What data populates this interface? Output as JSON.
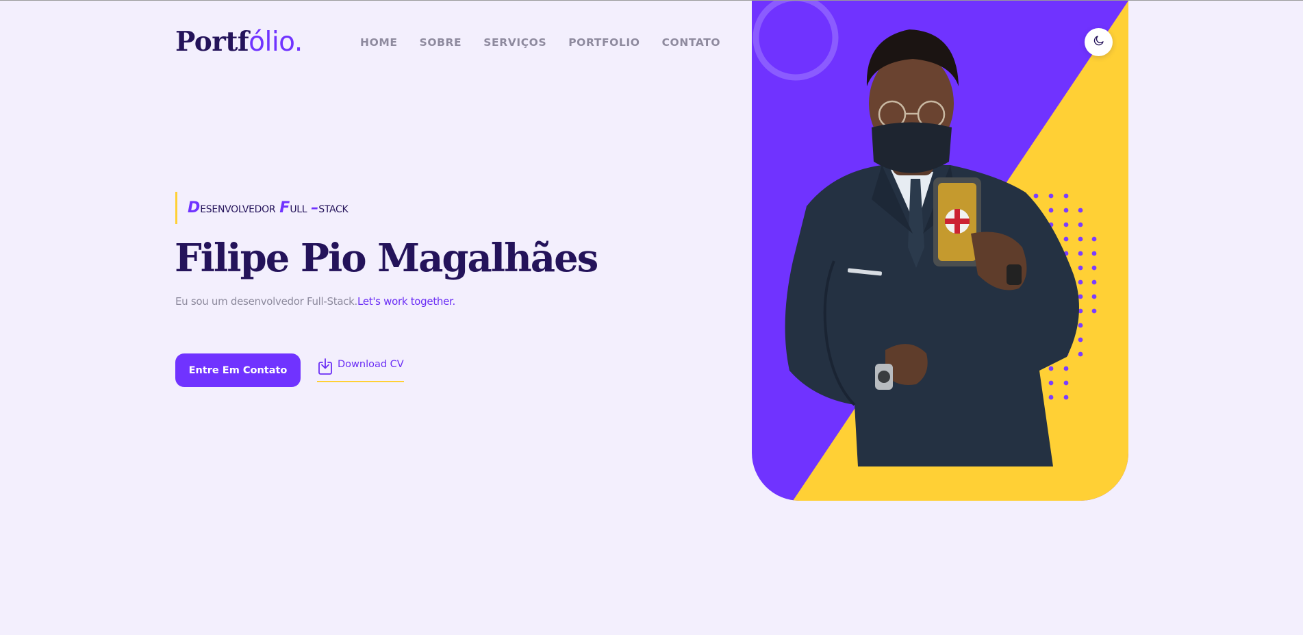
{
  "header": {
    "logo_main": "Portf",
    "logo_accent": "ólio.",
    "nav": [
      {
        "label": "HOME"
      },
      {
        "label": "SOBRE"
      },
      {
        "label": "SERVIÇOS"
      },
      {
        "label": "PORTFOLIO"
      },
      {
        "label": "CONTATO"
      }
    ]
  },
  "hero": {
    "role": {
      "d": "D",
      "esenvolvedor": "ESENVOLVEDOR",
      "f": "F",
      "ull": "ULL",
      "dash": "–",
      "stack": "STACK"
    },
    "name": "Filipe Pio Magalhães",
    "description": "Eu sou um desenvolvedor Full-Stack.",
    "description_highlight": "Let's work together.",
    "cta_label": "Entre Em Contato",
    "download_label": "Download CV"
  },
  "icons": {
    "theme_toggle": "moon-icon",
    "download": "download-icon"
  },
  "colors": {
    "background": "#f3effd",
    "primary": "#7033ff",
    "accent_yellow": "#ffd035",
    "heading": "#24135a",
    "muted": "#8d8a9d"
  }
}
